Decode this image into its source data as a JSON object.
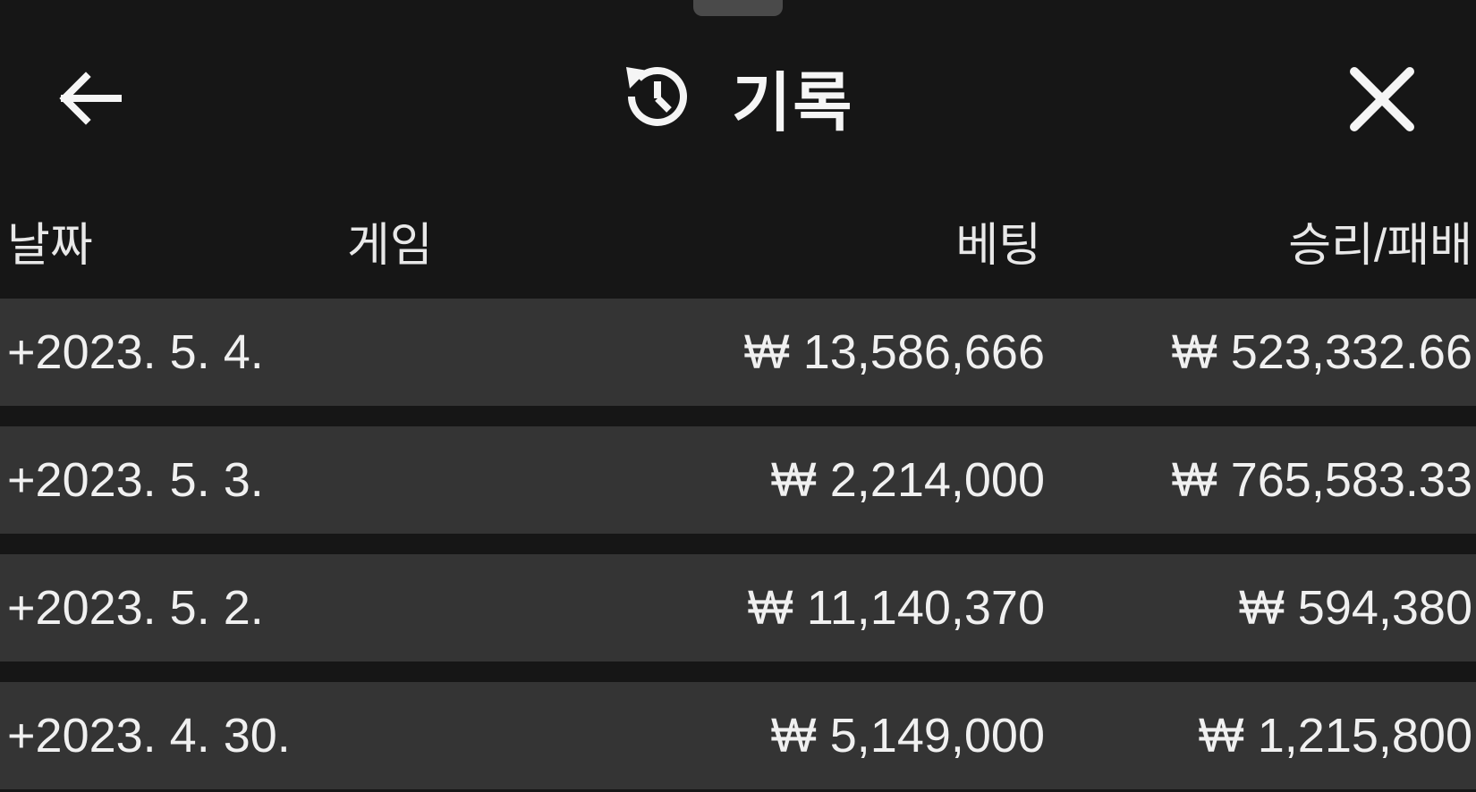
{
  "header": {
    "title": "기록",
    "icons": {
      "back": "arrow-left-icon",
      "history": "history-clock-icon",
      "close": "close-icon"
    }
  },
  "columns": {
    "date": "날짜",
    "game": "게임",
    "bet": "베팅",
    "result": "승리/패배"
  },
  "rows": [
    {
      "date": "+2023. 5. 4.",
      "bet": "₩ 13,586,666",
      "result": "₩ 523,332.66"
    },
    {
      "date": "+2023. 5. 3.",
      "bet": "₩ 2,214,000",
      "result": "₩ 765,583.33"
    },
    {
      "date": "+2023. 5. 2.",
      "bet": "₩ 11,140,370",
      "result": "₩ 594,380"
    },
    {
      "date": "+2023. 4. 30.",
      "bet": "₩ 5,149,000",
      "result": "₩ 1,215,800"
    }
  ],
  "colors": {
    "background": "#161616",
    "row": "#343434",
    "text": "#f0f0f0"
  }
}
